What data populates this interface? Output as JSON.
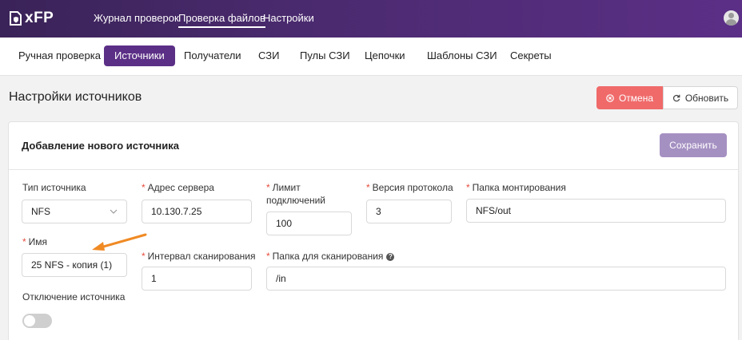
{
  "app": {
    "logo_text": "xFP"
  },
  "top_nav": [
    {
      "label": "Журнал проверок",
      "active": false
    },
    {
      "label": "Проверка файлов",
      "active": true
    },
    {
      "label": "Настройки",
      "active": false
    }
  ],
  "sub_nav": [
    {
      "label": "Ручная проверка",
      "active": false
    },
    {
      "label": "Источники",
      "active": true
    },
    {
      "label": "Получатели",
      "active": false
    },
    {
      "label": "СЗИ",
      "active": false
    },
    {
      "label": "Пулы СЗИ",
      "active": false
    },
    {
      "label": "Цепочки",
      "active": false
    },
    {
      "label": "Шаблоны СЗИ",
      "active": false
    },
    {
      "label": "Секреты",
      "active": false
    }
  ],
  "page": {
    "title": "Настройки источников",
    "cancel_label": "Отмена",
    "refresh_label": "Обновить"
  },
  "card": {
    "title": "Добавление нового источника",
    "save_label": "Сохранить"
  },
  "form": {
    "required_mark": "*",
    "source_type": {
      "label": "Тип источника",
      "value": "NFS"
    },
    "server_address": {
      "label": "Адрес сервера",
      "value": "10.130.7.25"
    },
    "connection_limit": {
      "label_line1": "Лимит",
      "label_line2": "подключений",
      "value": "100"
    },
    "protocol_version": {
      "label": "Версия протокола",
      "value": "3"
    },
    "mount_folder": {
      "label": "Папка монтирования",
      "value": "NFS/out"
    },
    "name": {
      "label": "Имя",
      "value": "25 NFS - копия (1)"
    },
    "scan_interval": {
      "label": "Интервал сканирования",
      "value": "1"
    },
    "scan_folder": {
      "label": "Папка для сканирования",
      "value": "/in"
    },
    "disable_source": {
      "label": "Отключение источника",
      "enabled": false
    }
  },
  "colors": {
    "topbar": "#4a2a6e",
    "accent": "#5b2f86",
    "cancel": "#f06a6a",
    "save": "#a590c2",
    "annotation_arrow": "#f08a24"
  }
}
